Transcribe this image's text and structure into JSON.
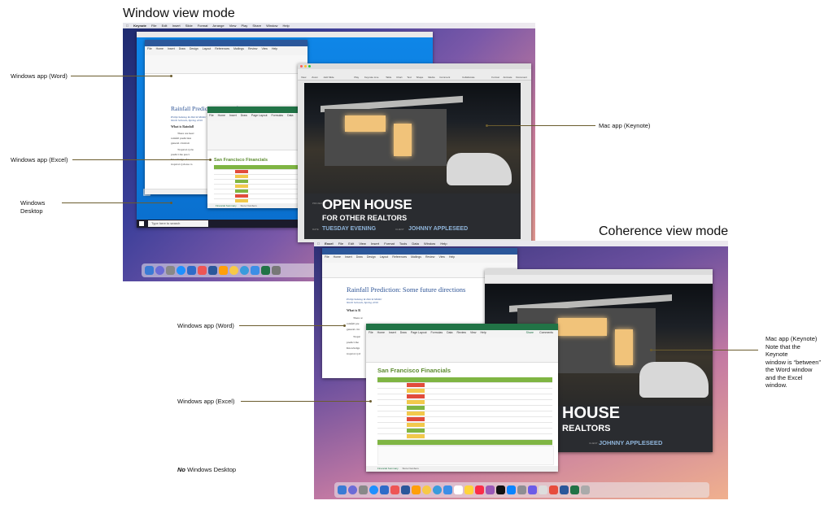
{
  "headings": {
    "window_mode": "Window view mode",
    "coherence_mode": "Coherence view mode"
  },
  "callouts": {
    "win_word_1": "Windows app (Word)",
    "win_excel_1": "Windows app (Excel)",
    "win_desktop_line1": "Windows",
    "win_desktop_line2": "Desktop",
    "mac_keynote_1": "Mac app (Keynote)",
    "win_word_2": "Windows app (Word)",
    "win_excel_2": "Windows app (Excel)",
    "mac_keynote_2_l1": "Mac app (Keynote)",
    "mac_keynote_2_l2": "Note that the",
    "mac_keynote_2_l3": "Keynote",
    "mac_keynote_2_l4": "window is “between”",
    "mac_keynote_2_l5": "the Word window",
    "mac_keynote_2_l6": "and the Excel",
    "mac_keynote_2_l7": "window.",
    "no_desktop_em": "No",
    "no_desktop_rest": " Windows Desktop"
  },
  "screen1": {
    "menubar": [
      "Keynote",
      "File",
      "Edit",
      "Insert",
      "Slide",
      "Format",
      "Arrange",
      "View",
      "Play",
      "Share",
      "Window",
      "Help"
    ],
    "word_ribbon": [
      "File",
      "Home",
      "Insert",
      "Draw",
      "Design",
      "Layout",
      "References",
      "Mailings",
      "Review",
      "View",
      "Help"
    ],
    "doc_title": "Rainfall Prediction: Some future directions",
    "doc_authors": "Philip Sabong & Patrik Müller",
    "doc_school": "North Schools, Spring 2019",
    "doc_heading": "What is Rainfall",
    "doc_lines": [
      "There are heav",
      "rainfall prediction",
      "general circulati",
      "Tropical cycle",
      "predict the preci",
      "Knowledge of c",
      "tropical cyclone ca"
    ],
    "excel_title": "San Francisco Financials",
    "excel_tab": "Financial Summary",
    "excel_tab2": "Store Numbers",
    "excel_ribbon": [
      "File",
      "Home",
      "Insert",
      "Draw",
      "Page Layout",
      "Formulas",
      "Data"
    ],
    "taskbar_search": "Type here to search",
    "keynote_toolbar": [
      "View",
      "Zoom",
      "Add Slide",
      "Play",
      "Keynote Live",
      "Table",
      "Chart",
      "Text",
      "Shape",
      "Media",
      "Comment",
      "Collaborate",
      "Format",
      "Animate",
      "Document"
    ],
    "slide": {
      "project_label": "PROJECT",
      "title": "OPEN HOUSE",
      "subtitle": "FOR OTHER REALTORS",
      "date_label": "DATE",
      "date": "TUESDAY EVENING",
      "client_label": "CLIENT",
      "client": "JOHNNY APPLESEED"
    }
  },
  "screen2": {
    "menubar": [
      "Excel",
      "File",
      "Edit",
      "View",
      "Insert",
      "Format",
      "Tools",
      "Data",
      "Window",
      "Help"
    ],
    "word_ribbon": [
      "File",
      "Home",
      "Insert",
      "Draw",
      "Design",
      "Layout",
      "References",
      "Mailings",
      "Review",
      "View",
      "Help"
    ],
    "doc_title": "Rainfall Prediction: Some future directions",
    "doc_authors": "Philip Sabong & Patrik Müller",
    "doc_school": "North Schools, Spring 2019",
    "doc_heading": "What is R",
    "doc_lines": [
      "There ar",
      "rainfall pre",
      "general circ",
      "Tropic",
      "predict the",
      "Knowledge",
      "tropical cycl"
    ],
    "excel_ribbon": [
      "File",
      "Home",
      "Insert",
      "Draw",
      "Page Layout",
      "Formulas",
      "Data",
      "Review",
      "View",
      "Help"
    ],
    "excel_share": "Share",
    "excel_comments": "Comments",
    "excel_title": "San Francisco Financials",
    "excel_tab": "Financial Summary",
    "excel_tab2": "Store Numbers",
    "slide": {
      "title": "HOUSE",
      "subtitle": "REALTORS",
      "client_label": "CLIENT",
      "client": "JOHNNY APPLESEED"
    }
  },
  "colors": {
    "leader": "#6b5c2e",
    "word_blue": "#2b579a",
    "excel_green": "#217346"
  }
}
